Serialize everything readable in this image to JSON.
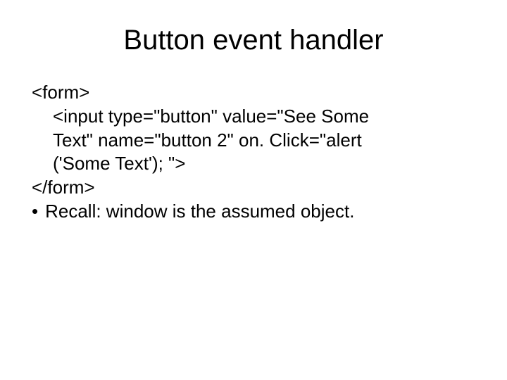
{
  "slide": {
    "title": "Button event handler",
    "code": {
      "line1": "<form>",
      "line2": "<input type=\"button\" value=\"See Some",
      "line3": "Text\" name=\"button 2\" on. Click=\"alert",
      "line4": "('Some Text'); \">",
      "line5": "</form>"
    },
    "bullet": {
      "marker": "•",
      "text": "Recall: window is the assumed object."
    }
  }
}
